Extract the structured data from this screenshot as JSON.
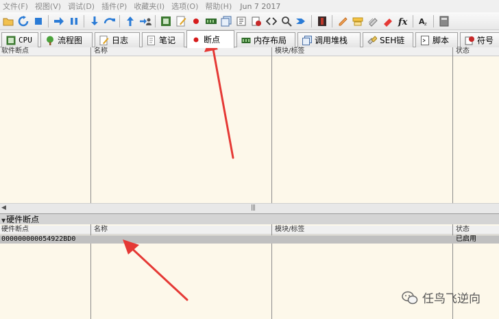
{
  "menu": {
    "items": [
      "文件(F)",
      "视图(V)",
      "调试(D)",
      "插件(P)",
      "收藏夹(I)",
      "选项(O)",
      "帮助(H)"
    ],
    "date": "Jun 7 2017"
  },
  "toolbar": {
    "icons": [
      "open-icon",
      "restart-icon",
      "stop-icon",
      "run-icon",
      "pause-icon",
      "step-into-icon",
      "step-over-icon",
      "execute-till-return-icon",
      "run-to-user-code-icon",
      "cpu-icon",
      "notes-icon",
      "breakpoint-icon",
      "memory-icon",
      "call-stack-icon",
      "seh-icon",
      "script-icon",
      "symbols-icon",
      "source-icon",
      "references-icon",
      "trace-icon",
      "patch-icon",
      "comments-icon",
      "labels-icon",
      "bookmarks-icon",
      "functions-icon",
      "font-icon",
      "calculator-icon"
    ]
  },
  "tabs": [
    {
      "label": "CPU",
      "icon": "cpu-icon"
    },
    {
      "label": "流程图",
      "icon": "tree-icon"
    },
    {
      "label": "日志",
      "icon": "log-icon"
    },
    {
      "label": "笔记",
      "icon": "notes-icon"
    },
    {
      "label": "断点",
      "icon": "breakpoint-dot-icon",
      "active": true
    },
    {
      "label": "内存布局",
      "icon": "memory-icon"
    },
    {
      "label": "调用堆栈",
      "icon": "call-stack-icon"
    },
    {
      "label": "SEH链",
      "icon": "seh-icon"
    },
    {
      "label": "脚本",
      "icon": "script-icon"
    },
    {
      "label": "符号",
      "icon": "symbols-icon"
    }
  ],
  "software_bp": {
    "headers": [
      "软件断点",
      "名称",
      "模块/标签",
      "状态"
    ]
  },
  "hardware_bp": {
    "section_title": "硬件断点",
    "headers": [
      "硬件断点",
      "名称",
      "模块/标签",
      "状态"
    ],
    "rows": [
      {
        "address": "000000000054922BD0",
        "name": "",
        "module": "",
        "status": "已启用"
      }
    ]
  },
  "watermark": {
    "text": "任鸟飞逆向"
  },
  "colors": {
    "pane_bg": "#fdf8ea",
    "selected_row": "#c0c0c0",
    "arrow": "#e53935",
    "breakpoint_dot": "#d61b1b"
  }
}
